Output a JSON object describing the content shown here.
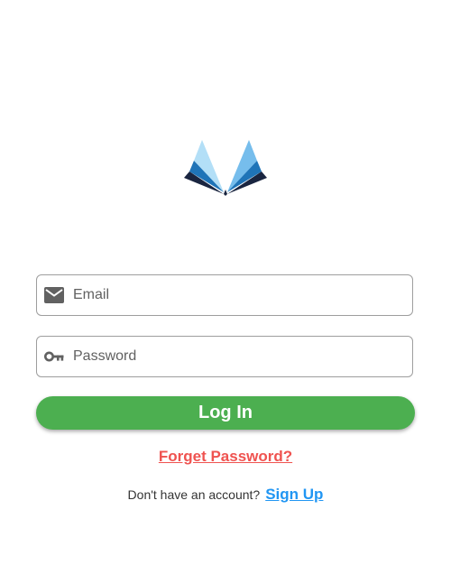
{
  "logo": {
    "icon": "open-book-icon",
    "colors": {
      "light_blue": "#b3dff7",
      "mid_blue": "#76bdec",
      "dark_blue": "#1f74b8",
      "navy": "#1a2540"
    }
  },
  "form": {
    "email": {
      "icon": "mail-icon",
      "placeholder": "Email",
      "value": ""
    },
    "password": {
      "icon": "key-icon",
      "placeholder": "Password",
      "value": ""
    },
    "login_label": "Log In",
    "forgot_label": "Forget Password?"
  },
  "signup": {
    "prompt": "Don't have an account?",
    "link_label": "Sign Up"
  },
  "colors": {
    "primary_button": "#4caf50",
    "forgot_link": "#ef5350",
    "signup_link": "#2196f3",
    "icon_gray": "#616161"
  }
}
